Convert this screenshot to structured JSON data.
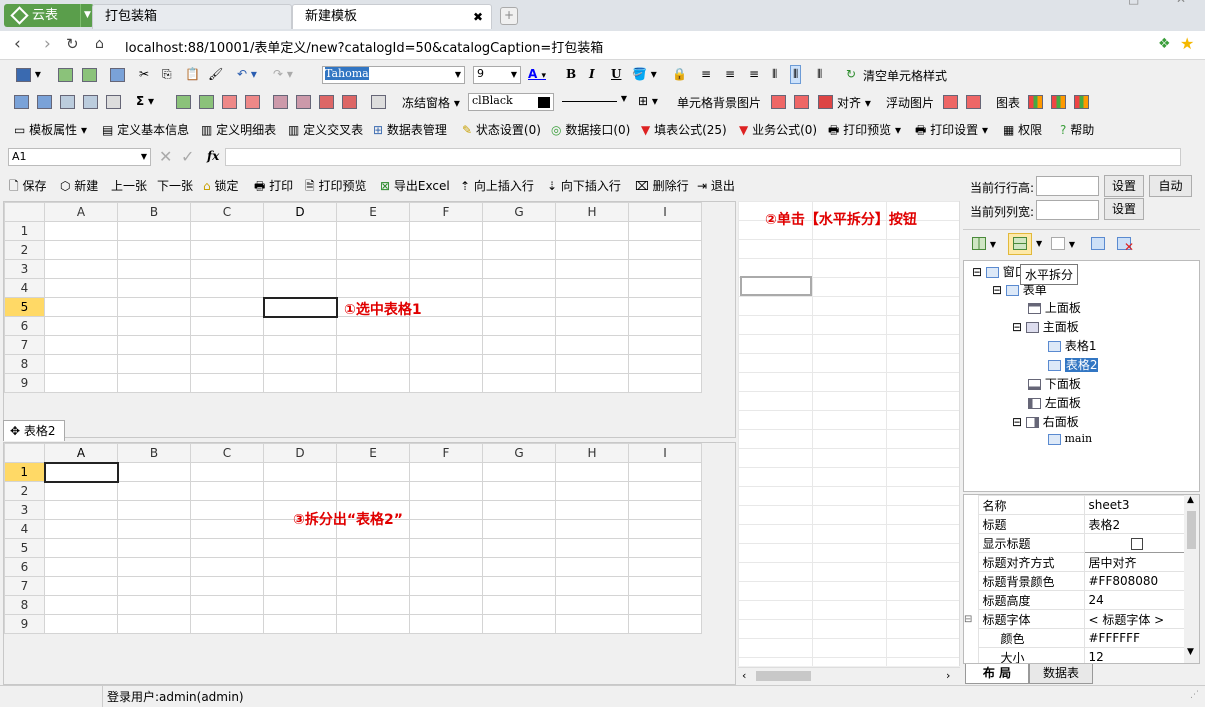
{
  "window": {
    "app_tab": "云表",
    "tabs": [
      "打包装箱",
      "新建模板"
    ],
    "controls": [
      "—",
      "□",
      "✕"
    ]
  },
  "address": {
    "url": "localhost:88/10001/表单定义/new?catalogId=50&catalogCaption=打包装箱"
  },
  "toolbar1": {
    "font_name": "Tahoma",
    "font_size": "9",
    "bold": "B",
    "italic": "I",
    "underline": "U",
    "clear_format": "清空单元格样式"
  },
  "toolbar2": {
    "freeze": "冻结窗格",
    "color_value": "clBlack",
    "cell_bg_image": "单元格背景图片",
    "align": "对齐",
    "float_image": "浮动图片",
    "chart": "图表",
    "sigma": "Σ"
  },
  "toolbar3": {
    "items": [
      "模板属性",
      "定义基本信息",
      "定义明细表",
      "定义交叉表",
      "数据表管理",
      "状态设置(0)",
      "数据接口(0)",
      "填表公式(25)",
      "业务公式(0)",
      "打印预览",
      "打印设置",
      "权限",
      "帮助"
    ]
  },
  "formula_bar": {
    "cell_ref": "A1",
    "fx": "fx",
    "value": ""
  },
  "form_toolbar": {
    "items": [
      "保存",
      "新建",
      "上一张",
      "下一张",
      "锁定",
      "打印",
      "打印预览",
      "导出Excel",
      "向上插入行",
      "向下插入行",
      "删除行",
      "退出"
    ]
  },
  "grid_columns": [
    "A",
    "B",
    "C",
    "D",
    "E",
    "F",
    "G",
    "H",
    "I"
  ],
  "grid_rows": [
    "1",
    "2",
    "3",
    "4",
    "5",
    "6",
    "7",
    "8",
    "9"
  ],
  "sheet2_tab": "表格2",
  "annotations": {
    "a1": "①选中表格1",
    "a2": "②单击【水平拆分】按钮",
    "a3": "③拆分出“表格2”"
  },
  "right_panel": {
    "row_height_label": "当前行行高:",
    "col_width_label": "当前列列宽:",
    "set1": "设置",
    "set2": "设置",
    "auto": "自动",
    "tooltip": "水平拆分"
  },
  "tree": {
    "root": "窗口",
    "form": "表单",
    "top": "上面板",
    "main": "主面板",
    "t1": "表格1",
    "t2": "表格2",
    "bottom": "下面板",
    "left": "左面板",
    "right": "右面板",
    "mainnode": "main"
  },
  "props": [
    {
      "k": "名称",
      "v": "sheet3"
    },
    {
      "k": "标题",
      "v": "表格2"
    },
    {
      "k": "显示标题",
      "v": ""
    },
    {
      "k": "标题对齐方式",
      "v": "居中对齐"
    },
    {
      "k": "标题背景颜色",
      "v": "#FF808080"
    },
    {
      "k": "标题高度",
      "v": "24"
    },
    {
      "k": "标题字体",
      "v": "< 标题字体 >"
    },
    {
      "k": "颜色",
      "v": "#FFFFFF"
    },
    {
      "k": "大小",
      "v": "12"
    }
  ],
  "bottom_tabs": {
    "layout": "布  局",
    "datatable": "数据表"
  },
  "status": {
    "user": "登录用户:admin(admin)"
  },
  "colors": {
    "accent_green": "#5a9e4b",
    "annotation_red": "#e00000",
    "selected_header": "#ffd966"
  }
}
